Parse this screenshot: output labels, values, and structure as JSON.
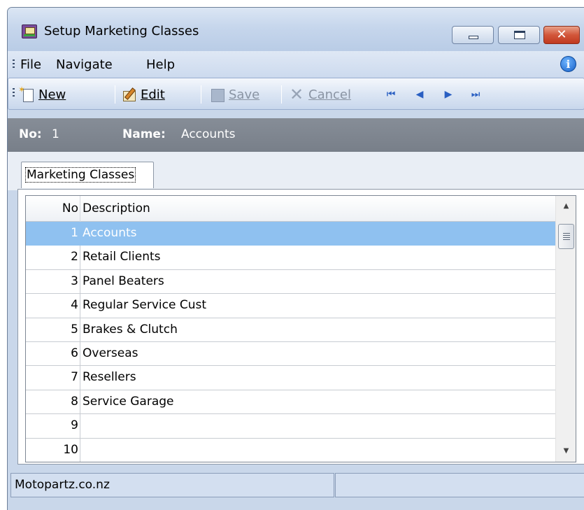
{
  "window": {
    "title": "Setup Marketing Classes",
    "close_glyph": "✕"
  },
  "menu": {
    "items": [
      "File",
      "Navigate",
      "Help"
    ],
    "info_glyph": "i"
  },
  "toolbar": {
    "new_label": "New",
    "edit_label": "Edit",
    "save_label": "Save",
    "cancel_label": "Cancel",
    "cancel_glyph": "✕",
    "nav_first": "⏮",
    "nav_prev": "◀",
    "nav_next": "▶",
    "nav_last": "⏭"
  },
  "record": {
    "no_label": "No:",
    "no_value": "1",
    "name_label": "Name:",
    "name_value": "Accounts"
  },
  "tabs": [
    {
      "label": "Marketing Classes",
      "active": true
    }
  ],
  "grid": {
    "columns": [
      "No",
      "Description"
    ],
    "selected_index": 0,
    "rows": [
      {
        "no": "1",
        "description": "Accounts"
      },
      {
        "no": "2",
        "description": "Retail Clients"
      },
      {
        "no": "3",
        "description": "Panel Beaters"
      },
      {
        "no": "4",
        "description": "Regular Service Cust"
      },
      {
        "no": "5",
        "description": "Brakes & Clutch"
      },
      {
        "no": "6",
        "description": "Overseas"
      },
      {
        "no": "7",
        "description": "Resellers"
      },
      {
        "no": "8",
        "description": "Service Garage"
      },
      {
        "no": "9",
        "description": ""
      },
      {
        "no": "10",
        "description": ""
      }
    ]
  },
  "scrollbar": {
    "up_glyph": "▲",
    "down_glyph": "▼"
  },
  "status": {
    "text": "Motopartz.co.nz"
  }
}
